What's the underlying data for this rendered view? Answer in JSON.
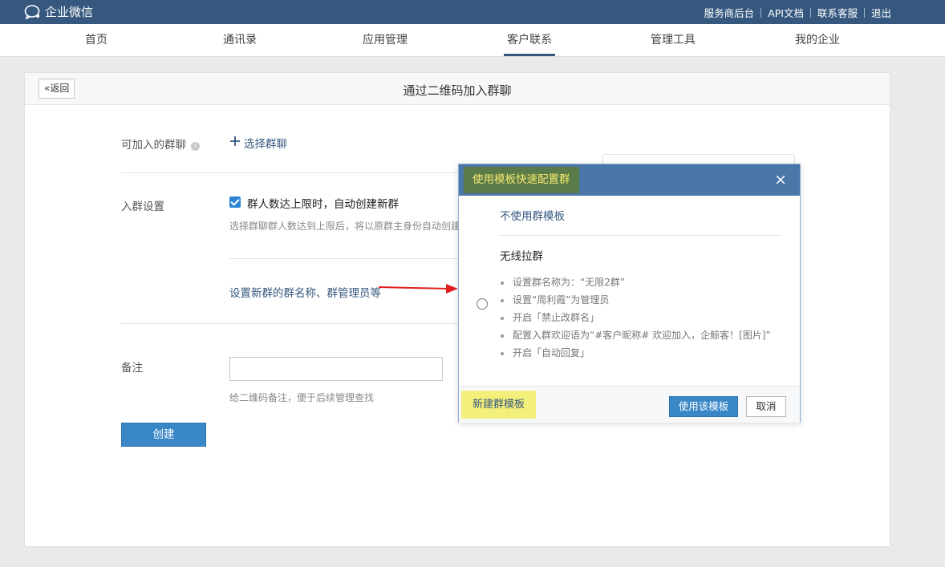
{
  "topbar": {
    "logo_text": "企业微信",
    "links": [
      "服务商后台",
      "API文档",
      "联系客服",
      "退出"
    ]
  },
  "nav": {
    "items": [
      "首页",
      "通讯录",
      "应用管理",
      "客户联系",
      "管理工具",
      "我的企业"
    ],
    "active": "客户联系"
  },
  "page": {
    "back_label": "返回",
    "title": "通过二维码加入群聊",
    "group_label": "可加入的群聊",
    "info_icon": "i",
    "select_group": "选择群聊",
    "join_settings_label": "入群设置",
    "auto_create_label": "群人数达上限时，自动创建新群",
    "auto_create_checked": true,
    "auto_create_hint": "选择群聊群人数达到上限后，将以原群主身份自动创建",
    "new_group_settings_link": "设置新群的群名称、群管理员等",
    "remark_label": "备注",
    "remark_value": "",
    "remark_hint": "给二维码备注，便于后续管理查找",
    "create_button": "创建"
  },
  "dialog": {
    "title": "使用模板快速配置群",
    "close_icon": "×",
    "no_template": "不使用群模板",
    "template": {
      "name": "无线拉群",
      "selected": false,
      "items": [
        "设置群名称为：“无限2群”",
        "设置“周利霞”为管理员",
        "开启「禁止改群名」",
        "配置入群欢迎语为“#客户昵称# 欢迎加入，企鲸客！[图片]”",
        "开启「自动回复」"
      ]
    },
    "new_template": "新建群模板",
    "use_button": "使用该模板",
    "cancel_button": "取消"
  },
  "colors": {
    "topbar": "#36587f",
    "accent_blue": "#3a87c8",
    "highlight_yellow": "#f2ef7a",
    "arrow_red": "#e02020"
  }
}
